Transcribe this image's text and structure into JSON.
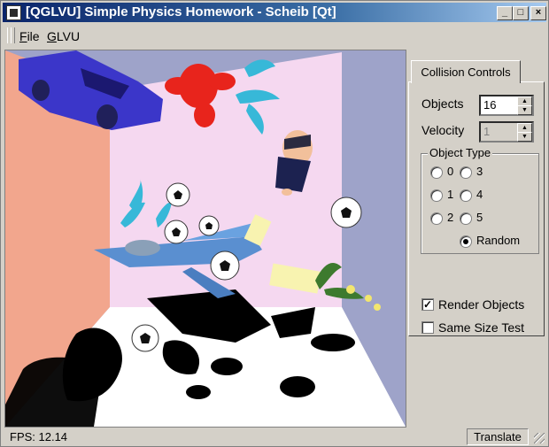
{
  "window": {
    "title": "[QGLVU] Simple Physics Homework - Scheib [Qt]",
    "minimize_glyph": "_",
    "maximize_glyph": "□",
    "close_glyph": "×"
  },
  "menubar": {
    "items": [
      {
        "label_first": "F",
        "label_rest": "ile"
      },
      {
        "label_first": "G",
        "label_rest": "LVU"
      }
    ]
  },
  "panel": {
    "tab_label": "Collision Controls",
    "objects": {
      "label": "Objects",
      "value": "16"
    },
    "velocity": {
      "label": "Velocity",
      "value": "1"
    },
    "object_type": {
      "title": "Object Type",
      "options": [
        "0",
        "1",
        "2",
        "3",
        "4",
        "5",
        "Random"
      ],
      "selected": "Random"
    },
    "render_objects": {
      "label": "Render Objects",
      "checked": true
    },
    "same_size_test": {
      "label": "Same Size Test",
      "checked": false
    }
  },
  "status": {
    "fps": "FPS: 12.14",
    "mode": "Translate"
  },
  "colors": {
    "title_bar_start": "#0a246a",
    "title_bar_end": "#a6caf0",
    "left_wall": "#f2a68d",
    "back_wall": "#f5d8f0",
    "right_wall": "#9ea3c9",
    "floor": "#ffffff",
    "car": "#3b36c9",
    "figure": "#e8241c",
    "dolphins": "#37b8d8",
    "plane": "#5a8fd0"
  }
}
